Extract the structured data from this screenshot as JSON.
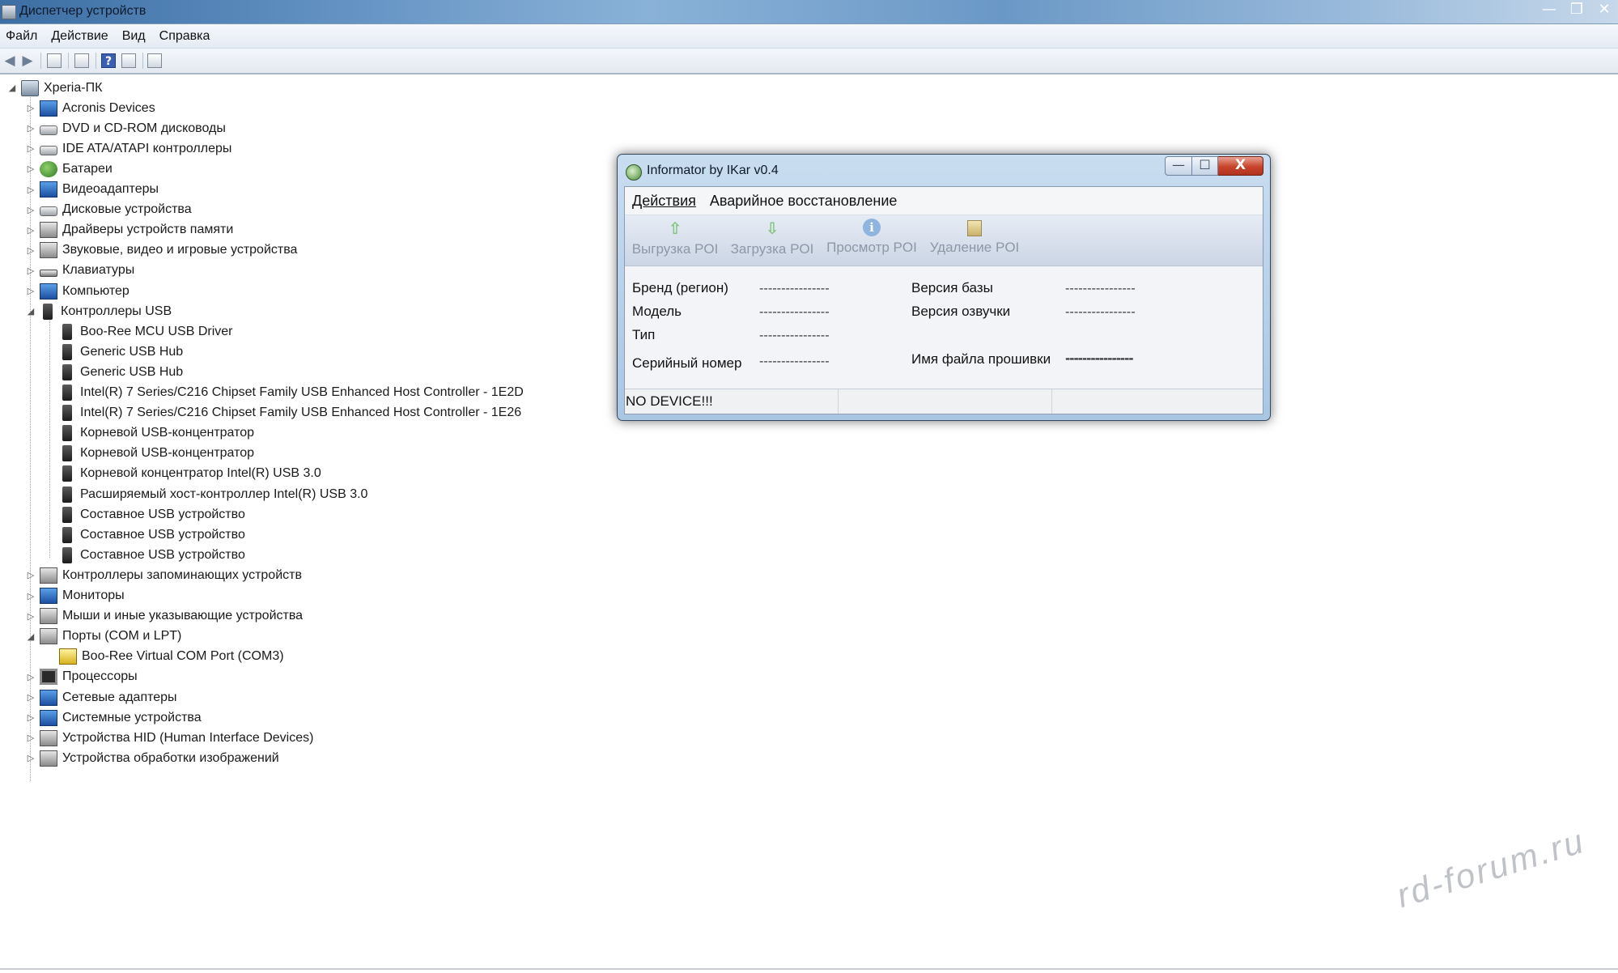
{
  "window": {
    "title": "Диспетчер устройств",
    "caption": {
      "minimize": "—",
      "restore": "❐",
      "close": "✕"
    }
  },
  "menu": [
    "Файл",
    "Действие",
    "Вид",
    "Справка"
  ],
  "toolbar": {
    "back_icon": "arrow-left-icon",
    "forward_icon": "arrow-right-icon",
    "help_glyph": "?"
  },
  "tree": {
    "root": "Xperia-ПК",
    "items": [
      {
        "label": "Acronis Devices",
        "level": 1,
        "expander": "▷",
        "icon": "blue"
      },
      {
        "label": "DVD и CD-ROM дисководы",
        "level": 1,
        "expander": "▷",
        "icon": "drive"
      },
      {
        "label": "IDE ATA/ATAPI контроллеры",
        "level": 1,
        "expander": "▷",
        "icon": "drive"
      },
      {
        "label": "Батареи",
        "level": 1,
        "expander": "▷",
        "icon": "green"
      },
      {
        "label": "Видеоадаптеры",
        "level": 1,
        "expander": "▷",
        "icon": "blue"
      },
      {
        "label": "Дисковые устройства",
        "level": 1,
        "expander": "▷",
        "icon": "drive"
      },
      {
        "label": "Драйверы устройств памяти",
        "level": 1,
        "expander": "▷",
        "icon": "gray"
      },
      {
        "label": "Звуковые, видео и игровые устройства",
        "level": 1,
        "expander": "▷",
        "icon": "gray"
      },
      {
        "label": "Клавиатуры",
        "level": 1,
        "expander": "▷",
        "icon": "kbd"
      },
      {
        "label": "Компьютер",
        "level": 1,
        "expander": "▷",
        "icon": "blue"
      },
      {
        "label": "Контроллеры USB",
        "level": 1,
        "expander": "◢",
        "icon": "usb"
      },
      {
        "label": "Boo-Ree MCU USB Driver",
        "level": 2,
        "expander": "",
        "icon": "usb"
      },
      {
        "label": "Generic USB Hub",
        "level": 2,
        "expander": "",
        "icon": "usb"
      },
      {
        "label": "Generic USB Hub",
        "level": 2,
        "expander": "",
        "icon": "usb"
      },
      {
        "label": "Intel(R) 7 Series/C216 Chipset Family USB Enhanced Host Controller - 1E2D",
        "level": 2,
        "expander": "",
        "icon": "usb"
      },
      {
        "label": "Intel(R) 7 Series/C216 Chipset Family USB Enhanced Host Controller - 1E26",
        "level": 2,
        "expander": "",
        "icon": "usb"
      },
      {
        "label": "Корневой USB-концентратор",
        "level": 2,
        "expander": "",
        "icon": "usb"
      },
      {
        "label": "Корневой USB-концентратор",
        "level": 2,
        "expander": "",
        "icon": "usb"
      },
      {
        "label": "Корневой концентратор Intel(R) USB 3.0",
        "level": 2,
        "expander": "",
        "icon": "usb"
      },
      {
        "label": "Расширяемый хост-контроллер Intel(R) USB 3.0",
        "level": 2,
        "expander": "",
        "icon": "usb"
      },
      {
        "label": "Составное USB устройство",
        "level": 2,
        "expander": "",
        "icon": "usb"
      },
      {
        "label": "Составное USB устройство",
        "level": 2,
        "expander": "",
        "icon": "usb"
      },
      {
        "label": "Составное USB устройство",
        "level": 2,
        "expander": "",
        "icon": "usb"
      },
      {
        "label": "Контроллеры запоминающих устройств",
        "level": 1,
        "expander": "▷",
        "icon": "gray"
      },
      {
        "label": "Мониторы",
        "level": 1,
        "expander": "▷",
        "icon": "blue"
      },
      {
        "label": "Мыши и иные указывающие устройства",
        "level": 1,
        "expander": "▷",
        "icon": "gray"
      },
      {
        "label": "Порты (COM и LPT)",
        "level": 1,
        "expander": "◢",
        "icon": "gray"
      },
      {
        "label": "Boo-Ree Virtual COM Port (COM3)",
        "level": 2,
        "expander": "",
        "icon": "warn"
      },
      {
        "label": "Процессоры",
        "level": 1,
        "expander": "▷",
        "icon": "chip"
      },
      {
        "label": "Сетевые адаптеры",
        "level": 1,
        "expander": "▷",
        "icon": "blue"
      },
      {
        "label": "Системные устройства",
        "level": 1,
        "expander": "▷",
        "icon": "blue"
      },
      {
        "label": "Устройства HID (Human Interface Devices)",
        "level": 1,
        "expander": "▷",
        "icon": "gray"
      },
      {
        "label": "Устройства обработки изображений",
        "level": 1,
        "expander": "▷",
        "icon": "gray"
      }
    ]
  },
  "dialog": {
    "title": "Informator by IKar v0.4",
    "caption": {
      "minimize": "—",
      "maximize": "☐",
      "close": "X"
    },
    "menu": [
      "Действия",
      "Аварийное восстановление"
    ],
    "tools": [
      {
        "label": "Выгрузка POI",
        "icon": "arrow-up-icon",
        "glyph": "⇧"
      },
      {
        "label": "Загрузка POI",
        "icon": "arrow-down-icon",
        "glyph": "⇩"
      },
      {
        "label": "Просмотр POI",
        "icon": "info-icon",
        "glyph": "i"
      },
      {
        "label": "Удаление POI",
        "icon": "eraser-icon",
        "glyph": ""
      }
    ],
    "fields": {
      "brand": {
        "label": "Бренд (регион)",
        "value": "----------------"
      },
      "model": {
        "label": "Модель",
        "value": "----------------"
      },
      "type": {
        "label": "Тип",
        "value": "----------------"
      },
      "serial": {
        "label": "Серийный номер",
        "value": "----------------"
      },
      "db_version": {
        "label": "Версия базы",
        "value": "----------------"
      },
      "voice_version": {
        "label": "Версия озвучки",
        "value": "----------------"
      },
      "firmware_file": {
        "label": "Имя файла прошивки",
        "value": "----------------"
      }
    },
    "status": "NO DEVICE!!!"
  },
  "watermark": "rd-forum.ru"
}
